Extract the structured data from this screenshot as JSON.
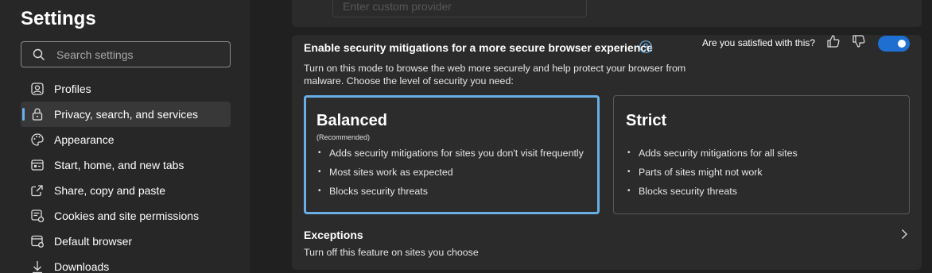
{
  "sidebar": {
    "title": "Settings",
    "search_placeholder": "Search settings",
    "items": [
      {
        "label": "Profiles",
        "icon": "profile-icon"
      },
      {
        "label": "Privacy, search, and services",
        "icon": "lock-icon",
        "active": true
      },
      {
        "label": "Appearance",
        "icon": "palette-icon"
      },
      {
        "label": "Start, home, and new tabs",
        "icon": "home-tabs-icon"
      },
      {
        "label": "Share, copy and paste",
        "icon": "share-icon"
      },
      {
        "label": "Cookies and site permissions",
        "icon": "cookies-icon"
      },
      {
        "label": "Default browser",
        "icon": "browser-icon"
      },
      {
        "label": "Downloads",
        "icon": "download-icon"
      }
    ]
  },
  "main": {
    "custom_provider_placeholder": "Enter custom provider",
    "security": {
      "title": "Enable security mitigations for a more secure browser experience",
      "description": "Turn on this mode to browse the web more securely and help protect your browser from malware. Choose the level of security you need:",
      "feedback_question": "Are you satisfied with this?",
      "toggle_on": true
    },
    "cards": {
      "balanced": {
        "title": "Balanced",
        "subtitle": "(Recommended)",
        "bullets": [
          "Adds security mitigations for sites you don't visit frequently",
          "Most sites work as expected",
          "Blocks security threats"
        ],
        "selected": true
      },
      "strict": {
        "title": "Strict",
        "bullets": [
          "Adds security mitigations for all sites",
          "Parts of sites might not work",
          "Blocks security threats"
        ],
        "selected": false
      }
    },
    "exceptions": {
      "title": "Exceptions",
      "description": "Turn off this feature on sites you choose"
    }
  },
  "colors": {
    "accent": "#1f6fd1",
    "selected_border": "#6aaee6",
    "background": "#202020",
    "panel": "#2b2b2b"
  }
}
